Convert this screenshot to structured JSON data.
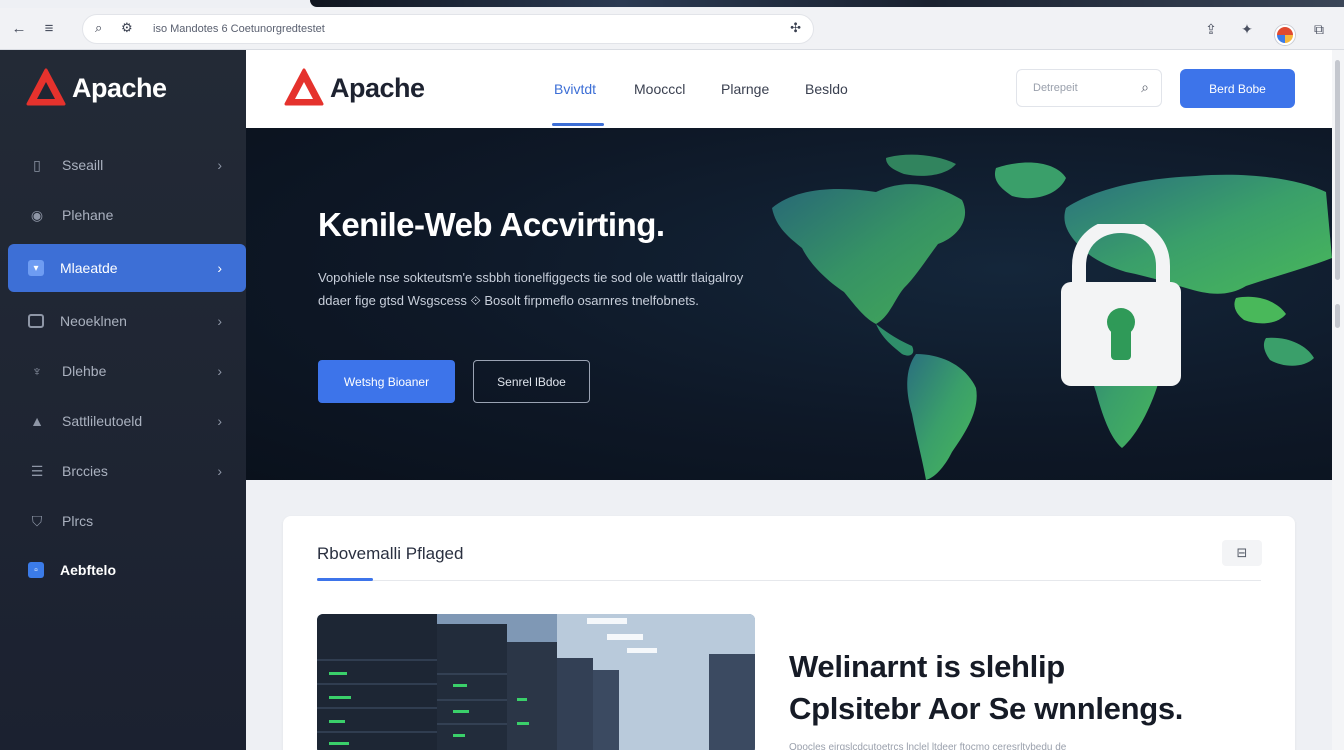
{
  "browser": {
    "url": "iso Mandotes 6 Coetunorgredtestet",
    "icons": [
      "back-icon",
      "menu-icon",
      "search-icon",
      "tune-icon",
      "extensions-icon",
      "download-icon",
      "pin-icon",
      "profile-avatar",
      "window-icon"
    ]
  },
  "brand": {
    "name": "Apache",
    "color": "#e5322d"
  },
  "sidebar": {
    "items": [
      {
        "label": "Sseaill",
        "icon": "mic-icon",
        "chevron": true
      },
      {
        "label": "Plehane",
        "icon": "target-icon",
        "chevron": false
      },
      {
        "label": "Mlaeatde",
        "icon": "shield-icon",
        "chevron": true,
        "active": true
      },
      {
        "label": "Neoeklnen",
        "icon": "window-icon",
        "chevron": true
      },
      {
        "label": "Dlehbe",
        "icon": "antenna-icon",
        "chevron": true
      },
      {
        "label": "Sattlileutoeld",
        "icon": "rocket-icon",
        "chevron": true
      },
      {
        "label": "Brccies",
        "icon": "server-icon",
        "chevron": true
      },
      {
        "label": "Plrcs",
        "icon": "basket-icon",
        "chevron": false
      },
      {
        "label": "Aebftelo",
        "icon": "app-icon",
        "chevron": false,
        "highlight": true
      }
    ]
  },
  "header": {
    "nav": [
      "Bvivtdt",
      "Moocccl",
      "Plarnge",
      "Besldo"
    ],
    "active_nav": 0,
    "search_placeholder": "Detrepeit",
    "cta_label": "Berd Bobe"
  },
  "hero": {
    "title": "Kenile-Web Accvirting.",
    "paragraph": "Vopohiele nse sokteutsm'e ssbbh tionelfiggects tie sod ole wattlr tlaigalroy ddaer fige gtsd Wsgscess ⟐ Bosolt firpmeflo osarnres tnelfobnets.",
    "primary_button": "Wetshg Bioaner",
    "secondary_button": "Senrel lBdoe",
    "accent_colors": {
      "map": "#3fae63",
      "lock": "#f3f4f5",
      "keyhole": "#2f9a58"
    }
  },
  "card": {
    "title": "Rbovemalli Pflaged",
    "headline_line1": "Welinarnt is slehlip",
    "headline_line2": "Cplsitebr Aor Se wnnlengs.",
    "footer_text": "Opocles eirgslcdcutoetrcs lnclel ltdeer ftocmo ceresrltvbedu de"
  }
}
